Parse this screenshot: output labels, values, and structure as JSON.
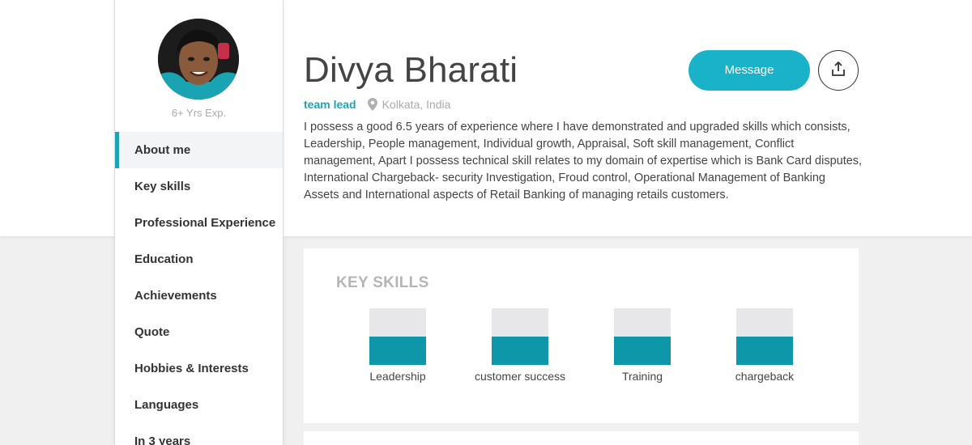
{
  "profile": {
    "name": "Divya Bharati",
    "experience": "6+ Yrs Exp.",
    "role": "team lead",
    "location": "Kolkata, India",
    "bio": "I possess a good 6.5 years of experience where I have demonstrated and upgraded skills which consists, Leadership, People management, Individual growth, Appraisal, Soft skill management, Conflict management, Apart I possess technical skill relates to my domain of expertise which is Bank Card disputes, International Chargeback- security Investigation, Froud control, Operational Management of Banking Assets and International aspects of Retail Banking of managing retails customers."
  },
  "actions": {
    "message_label": "Message",
    "share_icon": "share-upload-icon"
  },
  "nav": {
    "items": [
      {
        "label": "About me",
        "active": true
      },
      {
        "label": "Key skills",
        "active": false
      },
      {
        "label": "Professional Experience",
        "active": false
      },
      {
        "label": "Education",
        "active": false
      },
      {
        "label": "Achievements",
        "active": false
      },
      {
        "label": "Quote",
        "active": false
      },
      {
        "label": "Hobbies & Interests",
        "active": false
      },
      {
        "label": "Languages",
        "active": false
      },
      {
        "label": "In 3 years",
        "active": false
      }
    ]
  },
  "skills": {
    "title": "KEY SKILLS",
    "items": [
      {
        "label": "Leadership",
        "level": 0.5
      },
      {
        "label": "customer success",
        "level": 0.5
      },
      {
        "label": "Training",
        "level": 0.5
      },
      {
        "label": "chargeback",
        "level": 0.5
      }
    ]
  },
  "colors": {
    "accent": "#1fa3b5",
    "button": "#1ab2c9",
    "skill_fill": "#0e97a8",
    "skill_track": "#e7e7ea"
  }
}
